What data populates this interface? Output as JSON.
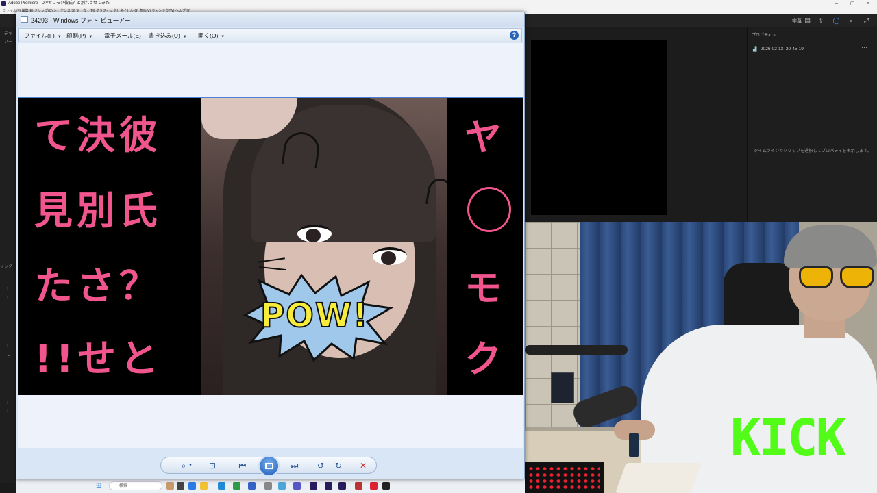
{
  "premiere": {
    "title": "Adobe Premiere - D:¥ヤリモク彼氏？と別れさせてみた",
    "menu": "ファイル(F)  編集(E)  クリップ(C)  シーケンス(S)  マーカー(M)  グラフィックとタイトル(G)  表示(V)  ウィンドウ(W)  ヘルプ(H)",
    "toolbar_label": "字幕",
    "properties_title": "プロパティ ≡",
    "clip_name": "2026-02-13_20-45-19",
    "properties_empty": "タイムラインでクリップを選択してプロパティを表示します。",
    "left_panel_labels": [
      "テキ",
      "ソー",
      "ィック"
    ]
  },
  "photo_viewer": {
    "title": "24293 - Windows フォト ビューアー",
    "menu": [
      {
        "label": "ファイル(F)"
      },
      {
        "label": "印刷(P)"
      },
      {
        "label": "電子メール(E)"
      },
      {
        "label": "書き込み(U)"
      },
      {
        "label": "開く(O)"
      }
    ],
    "help": "?",
    "caption_left": [
      "て決彼",
      "見別氏",
      "たさ？",
      "!!せと"
    ],
    "caption_right": [
      "ヤ",
      "モ",
      "ク"
    ],
    "pow_text": "POW!"
  },
  "controls": {
    "zoom": "⌕",
    "fit": "⊡",
    "previous": "⏮",
    "next": "⏭",
    "rotate_ccw": "↺",
    "rotate_cw": "↻",
    "delete": "✕"
  },
  "taskbar": {
    "search_placeholder": "検索"
  },
  "overlay": {
    "kick_logo": "KICK"
  },
  "colors": {
    "caption_pink": "#f0568d",
    "kick_green": "#53fc18",
    "pow_yellow": "#f7ec3a"
  }
}
